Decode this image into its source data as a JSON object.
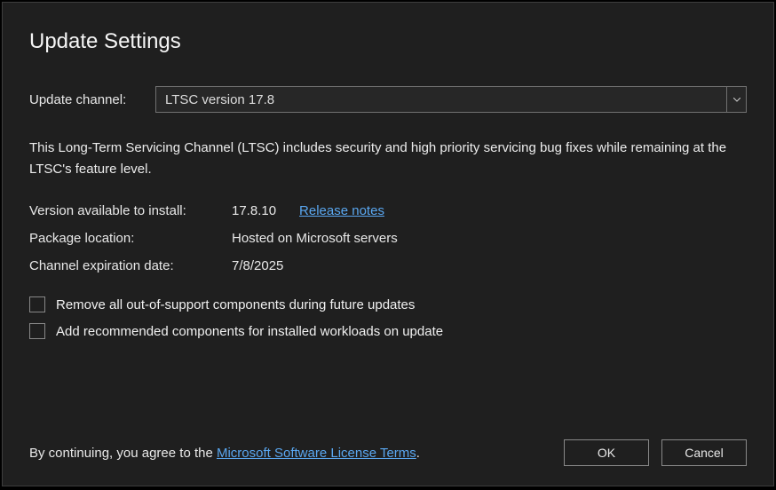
{
  "title": "Update Settings",
  "channel": {
    "label": "Update channel:",
    "selected": "LTSC version 17.8"
  },
  "description": "This Long-Term Servicing Channel (LTSC) includes security and high priority servicing bug fixes while remaining at the LTSC's feature level.",
  "info": {
    "version_label": "Version available to install:",
    "version_value": "17.8.10",
    "release_notes": "Release notes",
    "package_label": "Package location:",
    "package_value": "Hosted on Microsoft servers",
    "expiration_label": "Channel expiration date:",
    "expiration_value": "7/8/2025"
  },
  "checks": {
    "remove_oos": "Remove all out-of-support components during future updates",
    "add_recommended": "Add recommended components for installed workloads on update"
  },
  "footer": {
    "agree_prefix": "By continuing, you agree to the ",
    "license_link": "Microsoft Software License Terms",
    "agree_suffix": ".",
    "ok": "OK",
    "cancel": "Cancel"
  }
}
